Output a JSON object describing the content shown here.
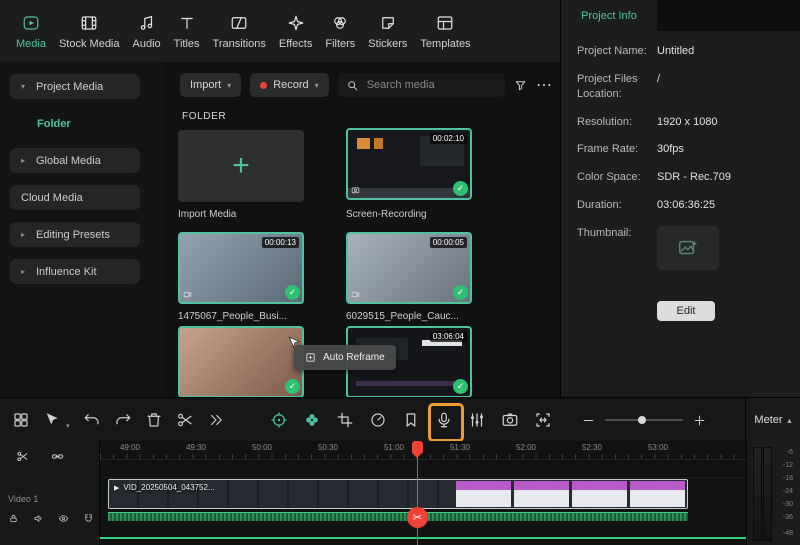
{
  "app": {
    "accent": "#4fc3a1",
    "annotation_color": "#f09a33"
  },
  "glyphs": {
    "check": "✓",
    "scissors": "✂",
    "play": "▶",
    "caret_down": "▾",
    "caret_up": "▴",
    "plus": "+",
    "more": "⋯"
  },
  "topnav": {
    "tabs": [
      {
        "label": "Media"
      },
      {
        "label": "Stock Media"
      },
      {
        "label": "Audio"
      },
      {
        "label": "Titles"
      },
      {
        "label": "Transitions"
      },
      {
        "label": "Effects"
      },
      {
        "label": "Filters"
      },
      {
        "label": "Stickers"
      },
      {
        "label": "Templates"
      }
    ]
  },
  "sidebar": {
    "items": [
      {
        "label": "Project Media"
      },
      {
        "label": "Folder"
      },
      {
        "label": "Global Media"
      },
      {
        "label": "Cloud Media"
      },
      {
        "label": "Editing Presets"
      },
      {
        "label": "Influence Kit"
      }
    ]
  },
  "media": {
    "import_label": "Import",
    "record_label": "Record",
    "search_placeholder": "Search media",
    "section": "FOLDER",
    "tiles": [
      {
        "label": "Import Media"
      },
      {
        "label": "Screen-Recording",
        "duration": "00:02:10"
      },
      {
        "label": "1475067_People_Busi...",
        "duration": "00:00:13"
      },
      {
        "label": "6029515_People_Cauc...",
        "duration": "00:00:05"
      },
      {},
      {
        "duration": "03:06:04"
      }
    ],
    "tooltip": "Auto Reframe"
  },
  "project_info": {
    "title": "Project Info",
    "fields": [
      {
        "label": "Project Name:",
        "value": "Untitled"
      },
      {
        "label": "Project Files Location:",
        "value": "/"
      },
      {
        "label": "Resolution:",
        "value": "1920 x 1080"
      },
      {
        "label": "Frame Rate:",
        "value": "30fps"
      },
      {
        "label": "Color Space:",
        "value": "SDR - Rec.709"
      },
      {
        "label": "Duration:",
        "value": "03:06:36:25"
      },
      {
        "label": "Thumbnail:",
        "value": ""
      }
    ],
    "edit_label": "Edit"
  },
  "toolbar": {
    "meter_label": "Meter"
  },
  "timeline": {
    "ruler": [
      "49:00",
      "49:30",
      "50:00",
      "50:30",
      "51:00",
      "51:30",
      "52:00",
      "52:30",
      "53:00"
    ],
    "track_label": "Video 1",
    "clip_name": "VID_20250504_043752...",
    "meter_scale": [
      "-6",
      "-12",
      "-18",
      "-24",
      "-30",
      "-36",
      "-48"
    ]
  }
}
